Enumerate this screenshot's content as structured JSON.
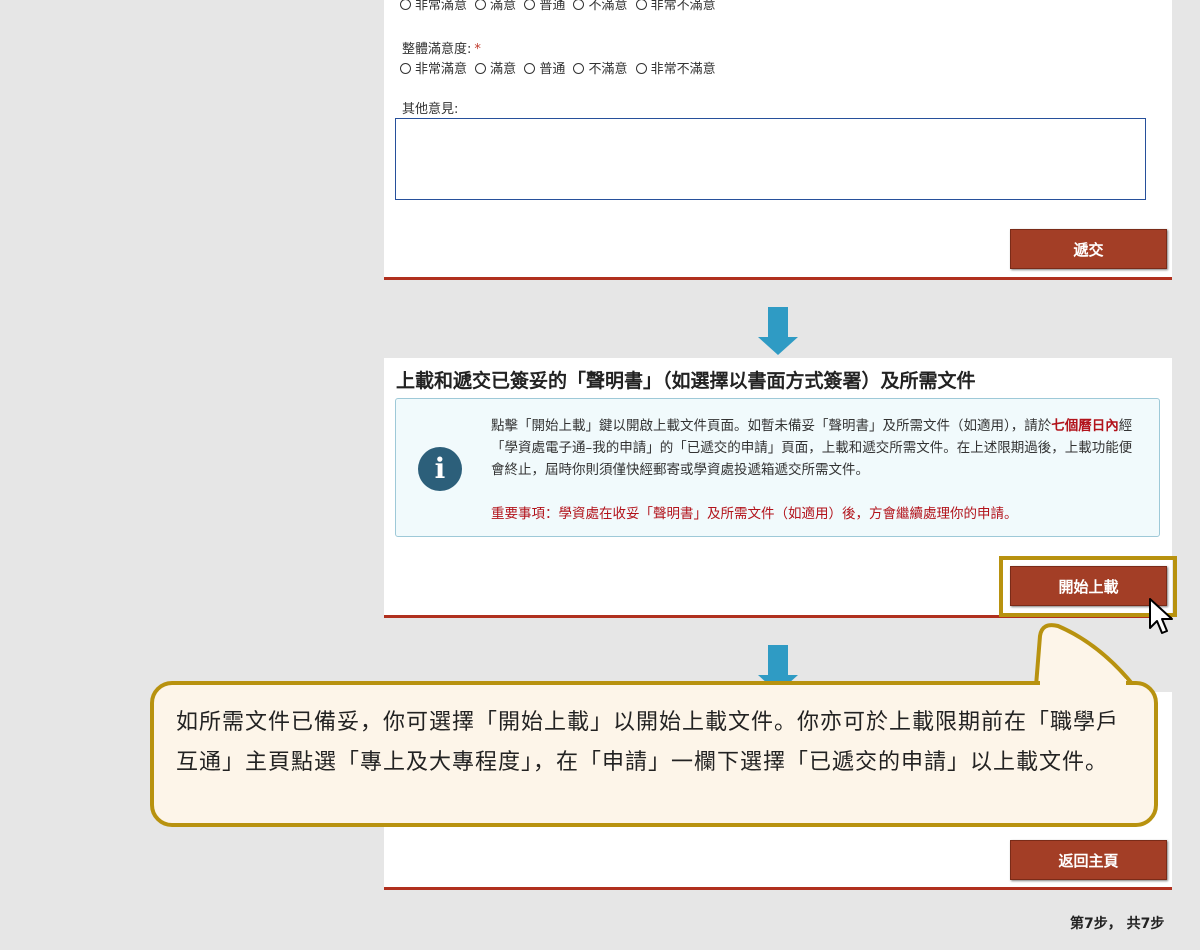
{
  "survey": {
    "options": [
      "非常滿意",
      "滿意",
      "普通",
      "不滿意",
      "非常不滿意"
    ],
    "overall_label": "整體滿意度:",
    "required_mark": "*",
    "comments_label": "其他意見:",
    "comments_value": "",
    "submit_label": "遞交"
  },
  "upload": {
    "title": "上載和遞交已簽妥的「聲明書」（如選擇以書面方式簽署）及所需文件",
    "info_part1": "點擊「開始上載」鍵以開啟上載文件頁面。如暫未備妥「聲明書」及所需文件（如適用），請於",
    "info_highlight": "七個曆日內",
    "info_part2": "經「學資處電子通–我的申請」的「已遞交的申請」頁面，上載和遞交所需文件。在上述限期過後，上載功能便會終止，屆時你則須僅快經郵寄或學資處投遞箱遞交所需文件。",
    "info_important": "重要事項：學資處在收妥「聲明書」及所需文件（如適用）後，方會繼續處理你的申請。",
    "start_button_label": "開始上載"
  },
  "callout": {
    "text": "如所需文件已備妥，你可選擇「開始上載」以開始上載文件。你亦可於上載限期前在「職學戶互通」主頁點選「專上及大專程度」，在「申請」一欄下選擇「已遞交的申請」以上載文件。"
  },
  "final": {
    "home_button_label": "返回主頁"
  },
  "footer": {
    "step_text": "第7步， 共7步"
  },
  "colors": {
    "accent_button": "#a33e26",
    "panel_border": "#b0301e",
    "highlight_frame": "#b8920f",
    "arrow": "#2f9bc4",
    "info_bg": "#f1fafc",
    "important_text": "#b2131b"
  },
  "icons": [
    "info-icon",
    "down-arrow-icon",
    "mouse-cursor-icon",
    "radio-icon"
  ]
}
